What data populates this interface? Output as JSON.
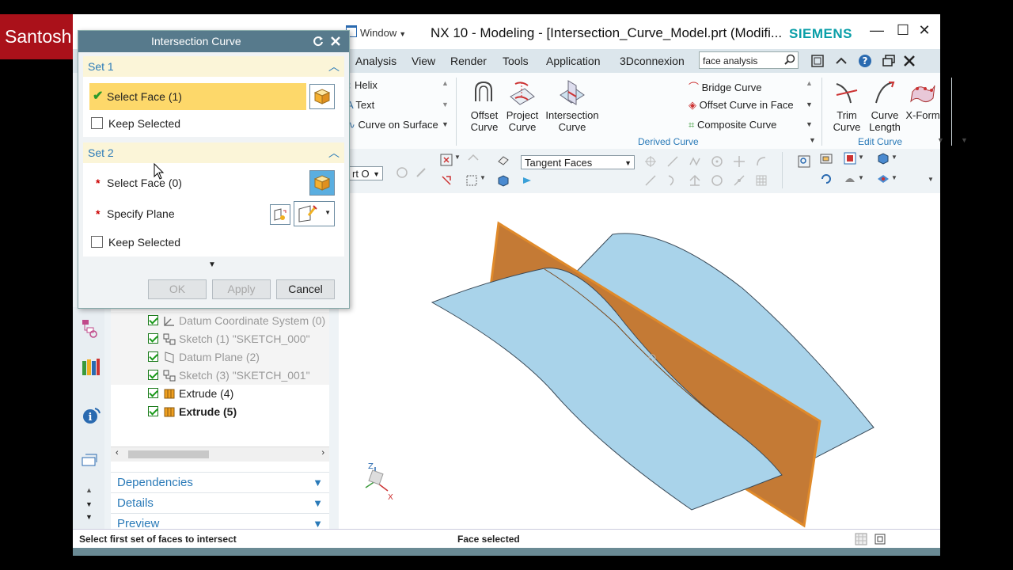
{
  "watermark": "Santosh Kumar",
  "title_bar": {
    "window_menu": "Window",
    "title": "NX 10 - Modeling - [Intersection_Curve_Model.prt (Modifi...",
    "brand": "SIEMENS"
  },
  "menubar": {
    "items": [
      "Analysis",
      "View",
      "Render",
      "Tools",
      "Application",
      "3Dconnexion"
    ],
    "search_value": "face analysis"
  },
  "ribbon": {
    "small_items_left": [
      "Helix",
      "Text",
      "Curve on Surface"
    ],
    "big_buttons": [
      {
        "line1": "Offset",
        "line2": "Curve"
      },
      {
        "line1": "Project",
        "line2": "Curve"
      },
      {
        "line1": "Intersection",
        "line2": "Curve"
      }
    ],
    "small_items_right": [
      "Bridge Curve",
      "Offset Curve in Face",
      "Composite Curve"
    ],
    "group_derived": "Derived Curve",
    "edit_buttons": [
      {
        "line1": "Trim",
        "line2": "Curve"
      },
      {
        "line1": "Curve",
        "line2": "Length"
      },
      {
        "line1": "X-Form",
        "line2": ""
      }
    ],
    "group_edit": "Edit Curve"
  },
  "toolbar2": {
    "part_combo": "rt O",
    "curve_rule": "Tangent Faces"
  },
  "dialog": {
    "title": "Intersection Curve",
    "set1": {
      "header": "Set 1",
      "select_face": "Select Face (1)",
      "keep_selected": "Keep Selected"
    },
    "set2": {
      "header": "Set 2",
      "select_face": "Select Face (0)",
      "specify_plane": "Specify Plane",
      "keep_selected": "Keep Selected"
    },
    "buttons": {
      "ok": "OK",
      "apply": "Apply",
      "cancel": "Cancel"
    }
  },
  "navigator": {
    "tree": [
      {
        "label": "Datum Coordinate System (0)",
        "active": false
      },
      {
        "label": "Sketch (1) \"SKETCH_000\"",
        "active": false
      },
      {
        "label": "Datum Plane (2)",
        "active": false
      },
      {
        "label": "Sketch (3) \"SKETCH_001\"",
        "active": false
      },
      {
        "label": "Extrude (4)",
        "active": true
      },
      {
        "label": "Extrude (5)",
        "active": true
      }
    ],
    "sections": [
      "Dependencies",
      "Details",
      "Preview"
    ]
  },
  "status": {
    "left": "Select first set of faces to intersect",
    "center": "Face selected"
  },
  "triad": {
    "z": "Z",
    "x": "X"
  },
  "colors": {
    "accent_blue": "#2a7ab8",
    "siemens_teal": "#0a9fa8",
    "dialog_title": "#577a8c",
    "selection_yellow": "#fdd86a",
    "surface_blue": "#a9d3ea",
    "plane_orange": "#c47a35"
  }
}
